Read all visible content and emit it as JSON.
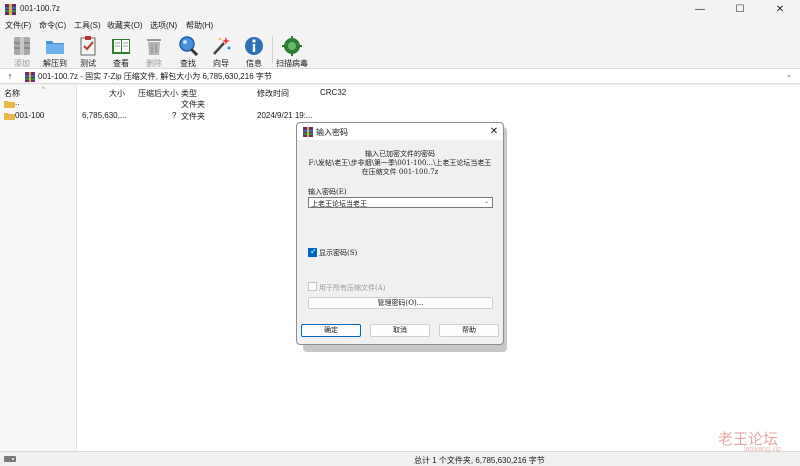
{
  "window": {
    "title": "001-100.7z",
    "icon": "7zip-archive-icon",
    "controls": [
      "—",
      "☐",
      "✕"
    ]
  },
  "menu": [
    "文件(F)",
    "命令(C)",
    "工具(S)",
    "收藏夹(O)",
    "选项(N)",
    "帮助(H)"
  ],
  "toolbar": [
    {
      "label": "添加",
      "icon": "add-icon",
      "enabled": false
    },
    {
      "label": "解压到",
      "icon": "extract-to-icon",
      "enabled": true
    },
    {
      "label": "测试",
      "icon": "test-icon",
      "enabled": true
    },
    {
      "label": "查看",
      "icon": "view-book-icon",
      "enabled": true
    },
    {
      "label": "删除",
      "icon": "delete-trash-icon",
      "enabled": false
    },
    {
      "label": "查找",
      "icon": "find-magnifier-icon",
      "enabled": true
    },
    {
      "label": "向导",
      "icon": "wizard-wand-icon",
      "enabled": true
    },
    {
      "label": "信息",
      "icon": "info-icon",
      "enabled": true
    },
    {
      "label": "扫描病毒",
      "icon": "virus-scan-icon",
      "enabled": true
    }
  ],
  "address": {
    "up_glyph": "↑",
    "text": "001-100.7z - 固实 7-Zip 压缩文件, 解包大小为 6,785,630,216 字节",
    "dropdown_glyph": "⌄"
  },
  "columns": [
    "名称",
    "大小",
    "压缩后大小",
    "类型",
    "修改时间",
    "CRC32"
  ],
  "sort_glyph": "^",
  "rows": [
    {
      "name": "..",
      "size": "",
      "packed": "",
      "type": "文件夹",
      "modified": "",
      "crc": ""
    },
    {
      "name": "001-100",
      "size": "6,785,630,...",
      "packed": "?",
      "type": "文件夹",
      "modified": "2024/9/21 19:...",
      "crc": ""
    }
  ],
  "status": {
    "text": "总计 1 个文件夹, 6,785,630,216 字节"
  },
  "dialog": {
    "title": "输入密码",
    "close_glyph": "✕",
    "message_lines": [
      "输入已加密文件的密码",
      "F:\\发帖\\老王\\步非烟\\第一季\\001-100...\\上老王论坛当老王",
      "在压缩文件 001-100.7z"
    ],
    "password_label": "输入密码(E)",
    "password_value": "上老王论坛当老王",
    "dropdown_glyph": "⌄",
    "show_password_label": "显示密码(S)",
    "show_password_checked": true,
    "check_glyph": "✓",
    "use_for_all_label": "用于所有压缩文件(A)",
    "use_for_all_checked": false,
    "manage_button": "管理密码(O)...",
    "ok": "确定",
    "cancel": "取消",
    "help": "帮助"
  },
  "watermark": {
    "line1": "老王论坛",
    "line2": "laowang.vip"
  }
}
